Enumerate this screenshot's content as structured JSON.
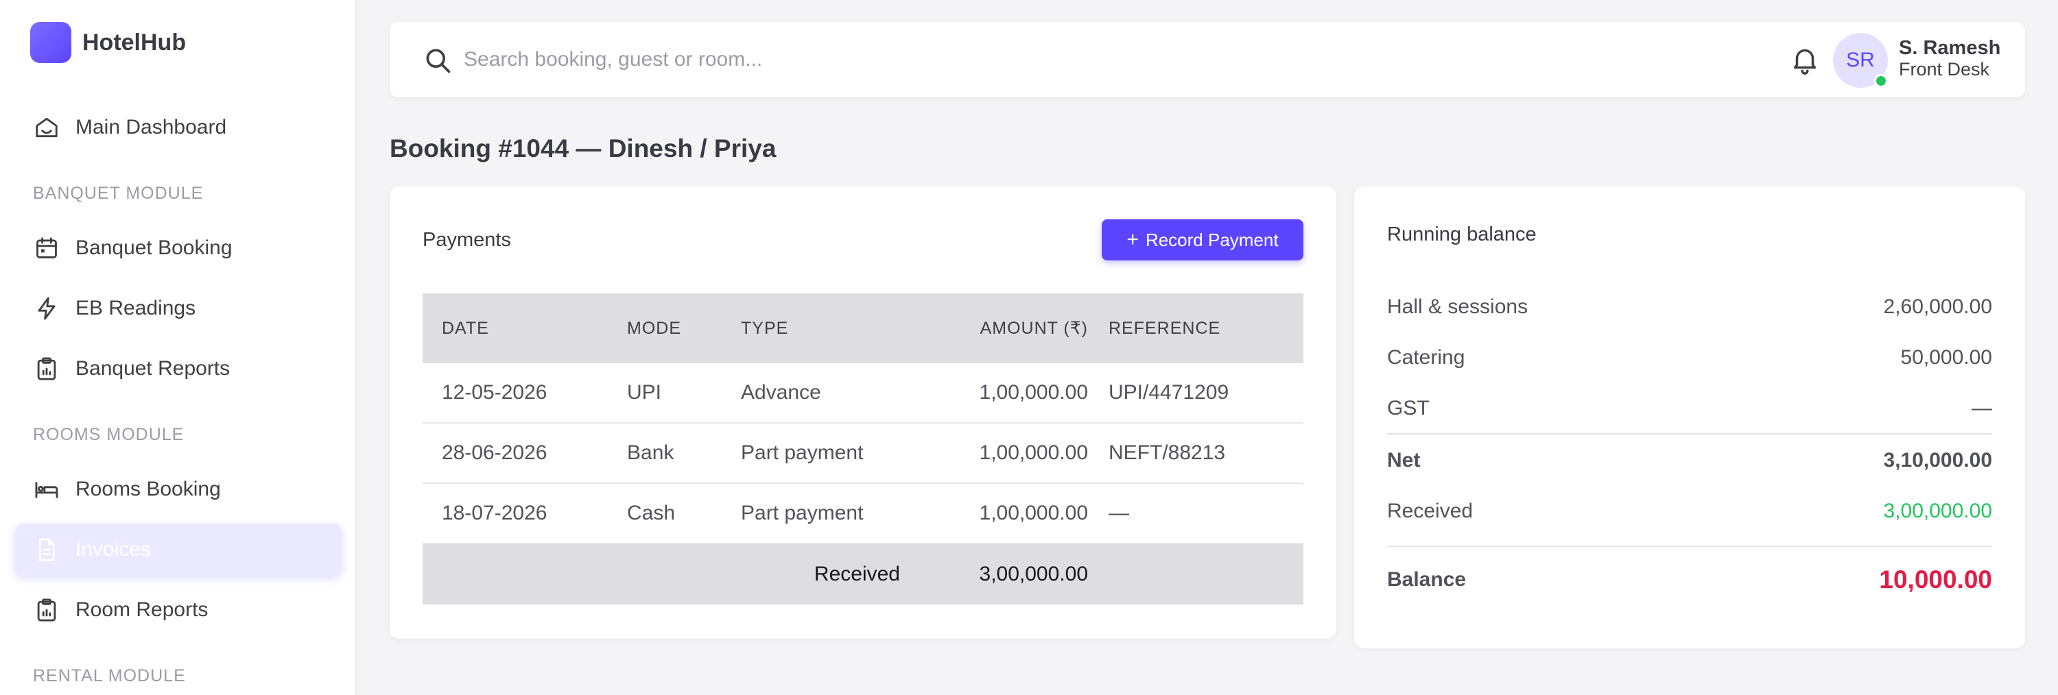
{
  "brand": {
    "name": "HotelHub"
  },
  "sidebar": {
    "main_item": {
      "label": "Main Dashboard",
      "icon": "home-icon"
    },
    "banquet_section": "BANQUET MODULE",
    "banquet_items": [
      {
        "label": "Banquet Booking",
        "icon": "calendar-icon"
      },
      {
        "label": "EB Readings",
        "icon": "lightning-icon"
      },
      {
        "label": "Banquet Reports",
        "icon": "clipboard-report-icon"
      }
    ],
    "rooms_section": "ROOMS MODULE",
    "rooms_items": [
      {
        "label": "Rooms Booking",
        "icon": "bed-icon"
      },
      {
        "label": "Invoices",
        "icon": "document-icon",
        "active": true
      },
      {
        "label": "Room Reports",
        "icon": "clipboard-report-icon"
      }
    ],
    "rental_section": "RENTAL MODULE"
  },
  "header": {
    "search_placeholder": "Search booking, guest or room...",
    "user": {
      "initials": "SR",
      "name": "S. Ramesh",
      "role": "Front Desk",
      "status": "online"
    }
  },
  "page": {
    "title": "Booking #1044 — Dinesh / Priya"
  },
  "payments": {
    "title": "Payments",
    "record_button": "Record Payment",
    "columns": [
      "DATE",
      "MODE",
      "TYPE",
      "AMOUNT (₹)",
      "REFERENCE"
    ],
    "rows": [
      {
        "date": "12-05-2026",
        "mode": "UPI",
        "type": "Advance",
        "amount": "1,00,000.00",
        "reference": "UPI/4471209"
      },
      {
        "date": "28-06-2026",
        "mode": "Bank",
        "type": "Part payment",
        "amount": "1,00,000.00",
        "reference": "NEFT/88213"
      },
      {
        "date": "18-07-2026",
        "mode": "Cash",
        "type": "Part payment",
        "amount": "1,00,000.00",
        "reference": "—"
      }
    ],
    "footer": {
      "label": "Received",
      "value": "3,00,000.00"
    }
  },
  "balance": {
    "title": "Running balance",
    "hall_label": "Hall & sessions",
    "hall_value": "2,60,000.00",
    "catering_label": "Catering",
    "catering_value": "50,000.00",
    "gst_label": "GST",
    "gst_value": "—",
    "net_label": "Net",
    "net_value": "3,10,000.00",
    "received_label": "Received",
    "received_value": "3,00,000.00",
    "balance_label": "Balance",
    "balance_value": "10,000.00"
  },
  "colors": {
    "accent": "#5b45ff",
    "received": "#22c55e",
    "balance_due": "#e11d48",
    "online": "#22c55e"
  }
}
